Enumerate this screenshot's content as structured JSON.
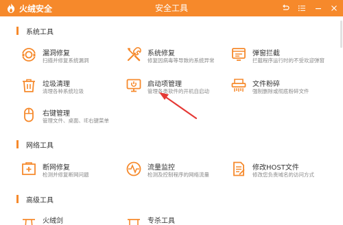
{
  "app": {
    "brand": "火绒安全",
    "window_title": "安全工具"
  },
  "sections": [
    {
      "title": "系统工具",
      "tools": [
        {
          "name": "漏洞修复",
          "desc": "扫描并修复系统漏洞",
          "icon": "vulnerability-fix-icon"
        },
        {
          "name": "系统修复",
          "desc": "修复因病毒等导致的系统异常",
          "icon": "system-repair-icon"
        },
        {
          "name": "弹窗拦截",
          "desc": "拦截程序运行时的不受欢迎弹窗",
          "icon": "popup-block-icon"
        },
        {
          "name": "垃圾清理",
          "desc": "清理各种系统垃圾",
          "icon": "trash-clean-icon"
        },
        {
          "name": "启动项管理",
          "desc": "管理各类软件的开机自启动",
          "icon": "startup-manage-icon"
        },
        {
          "name": "文件粉碎",
          "desc": "强制删除或彻底粉碎文件",
          "icon": "file-shredder-icon"
        },
        {
          "name": "右键管理",
          "desc": "管理文件、桌面、IE右键菜单",
          "icon": "right-click-mouse-icon"
        }
      ]
    },
    {
      "title": "网络工具",
      "tools": [
        {
          "name": "断网修复",
          "desc": "检测并修复断网问题",
          "icon": "network-repair-icon"
        },
        {
          "name": "流量监控",
          "desc": "检测及控制程序的网络流量",
          "icon": "traffic-monitor-icon"
        },
        {
          "name": "修改HOST文件",
          "desc": "修改您负责域名的访问方式",
          "icon": "host-file-icon"
        }
      ]
    },
    {
      "title": "高级工具",
      "tools": [
        {
          "name": "火绒剑",
          "desc": "",
          "icon": "huorong-sword-icon"
        },
        {
          "name": "专杀工具",
          "desc": "",
          "icon": "special-kill-icon"
        }
      ]
    }
  ],
  "colors": {
    "accent": "#f6892b",
    "annotation_arrow": "#e53935"
  }
}
